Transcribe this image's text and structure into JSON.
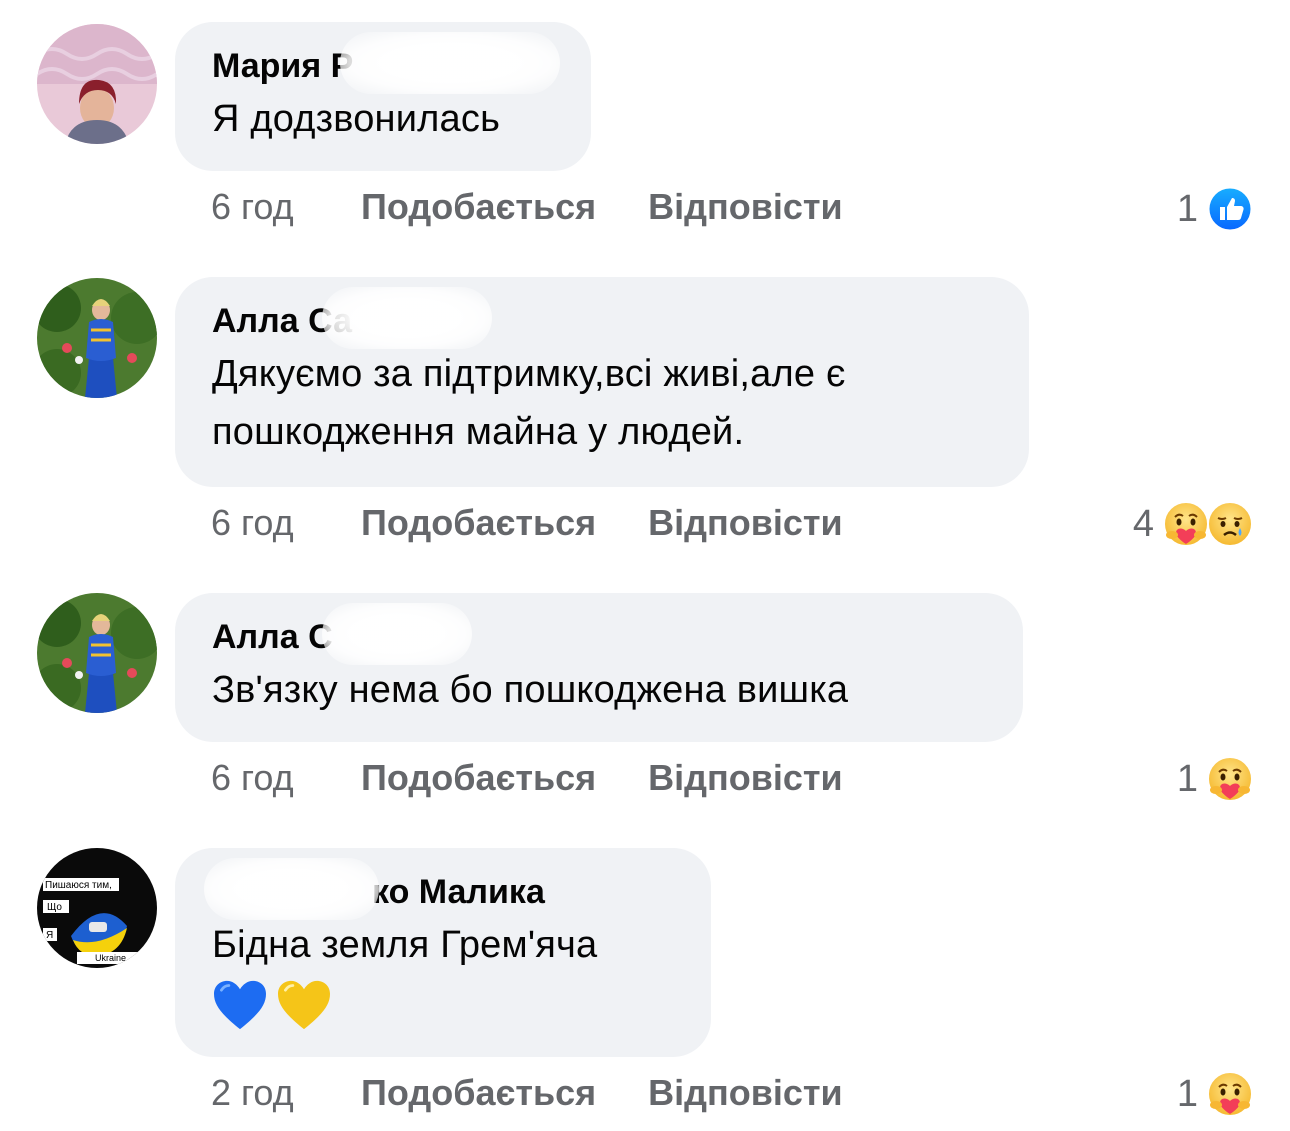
{
  "comments": [
    {
      "author": "Мария Р",
      "text": "Я додзвонилась",
      "time": "6 год",
      "like_label": "Подобається",
      "reply_label": "Відповісти",
      "reaction_count": "1",
      "reactions": [
        "like-reaction-icon"
      ]
    },
    {
      "author": "Алла Са",
      "text": "Дякуємо за підтримку,всі живі,але є пошкодження майна у людей.",
      "time": "6 год",
      "like_label": "Подобається",
      "reply_label": "Відповісти",
      "reaction_count": "4",
      "reactions": [
        "care-reaction-icon",
        "sad-reaction-icon"
      ]
    },
    {
      "author": "Алла С",
      "text": "Зв'язку нема бо пошкоджена вишка",
      "time": "6 год",
      "like_label": "Подобається",
      "reply_label": "Відповісти",
      "reaction_count": "1",
      "reactions": [
        "care-reaction-icon"
      ]
    },
    {
      "author": "ко Малика",
      "text": "Бідна земля Грем'яча",
      "emojis": [
        "blue-heart-emoji",
        "yellow-heart-emoji"
      ],
      "time": "2 год",
      "like_label": "Подобається",
      "reply_label": "Відповісти",
      "reaction_count": "1",
      "reactions": [
        "care-reaction-icon"
      ]
    }
  ],
  "avatar4_text": {
    "line1": "Пишаюся тим,",
    "line2": "Що",
    "line3": "Я",
    "line4": "Ukraine"
  },
  "colors": {
    "bubble": "#f0f2f5",
    "meta_text": "#65676b",
    "like_blue": "#1877f2",
    "heart_blue": "#1d6cf2",
    "heart_yellow": "#f5c518"
  }
}
